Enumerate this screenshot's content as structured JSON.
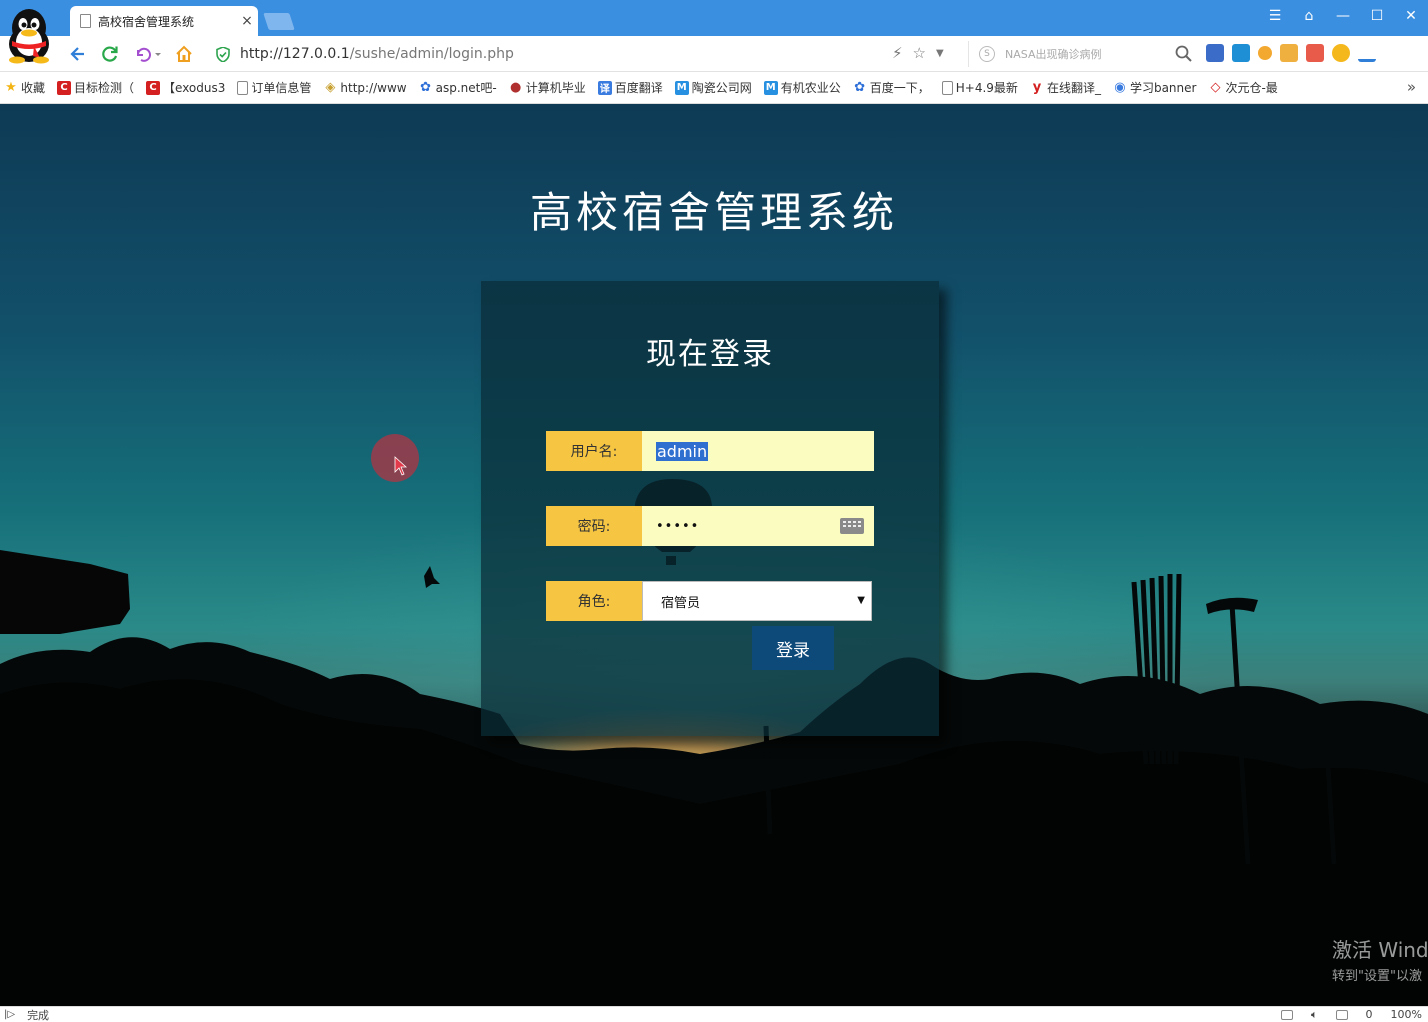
{
  "browser": {
    "tab_title": "高校宿舍管理系统",
    "tab_close": "×",
    "url_host": "http://127.0.0.1",
    "url_path": "/sushe/admin/login.php",
    "search_placeholder": "NASA出现确诊病例",
    "window_controls": [
      "☰",
      "⌂",
      "—",
      "☐",
      "✕"
    ],
    "bookmarks": [
      {
        "label": "收藏",
        "icon": "star-icon",
        "color": "#f3b515"
      },
      {
        "label": "目标检测（",
        "icon": "c-icon",
        "color": "#d42020"
      },
      {
        "label": "【exodus3",
        "icon": "c-icon",
        "color": "#d42020"
      },
      {
        "label": "订单信息管",
        "icon": "doc-icon",
        "color": "#ffffff"
      },
      {
        "label": "http://www",
        "icon": "layers-icon",
        "color": "#c8a030"
      },
      {
        "label": "asp.net吧-",
        "icon": "paw-icon",
        "color": "#2e6fd8"
      },
      {
        "label": "计算机毕业",
        "icon": "circle-icon",
        "color": "#b03030"
      },
      {
        "label": "百度翻译",
        "icon": "translate-icon",
        "color": "#3a7be0"
      },
      {
        "label": "陶瓷公司网",
        "icon": "m-icon",
        "color": "#2890e0"
      },
      {
        "label": "有机农业公",
        "icon": "m-icon",
        "color": "#2890e0"
      },
      {
        "label": "百度一下，",
        "icon": "paw-icon",
        "color": "#2e6fd8"
      },
      {
        "label": "H+4.9最新",
        "icon": "doc-icon",
        "color": "#ffffff"
      },
      {
        "label": "在线翻译_",
        "icon": "y-icon",
        "color": "#d42020"
      },
      {
        "label": "学习banner",
        "icon": "chrome-icon",
        "color": "#3a7be0"
      },
      {
        "label": "次元仓-最",
        "icon": "shield-icon",
        "color": "#d42020"
      }
    ],
    "bookmarks_more": "»",
    "status_text": "完成",
    "status_count": "0",
    "zoom": "100%"
  },
  "page": {
    "title": "高校宿舍管理系统",
    "login_heading": "现在登录",
    "username_label": "用户名:",
    "username_value": "admin",
    "password_label": "密码:",
    "password_value": "•••••",
    "role_label": "角色:",
    "role_value": "宿管员",
    "role_caret": "▼",
    "login_button": "登录"
  },
  "os": {
    "watermark_line1": "激活 Wind",
    "watermark_line2": "转到\"设置\"以激"
  },
  "colors": {
    "titlebar": "#3b8fe0",
    "label_bg": "#f6c542",
    "input_bg": "#fbfcc0",
    "button_bg": "#0d4a7a"
  }
}
